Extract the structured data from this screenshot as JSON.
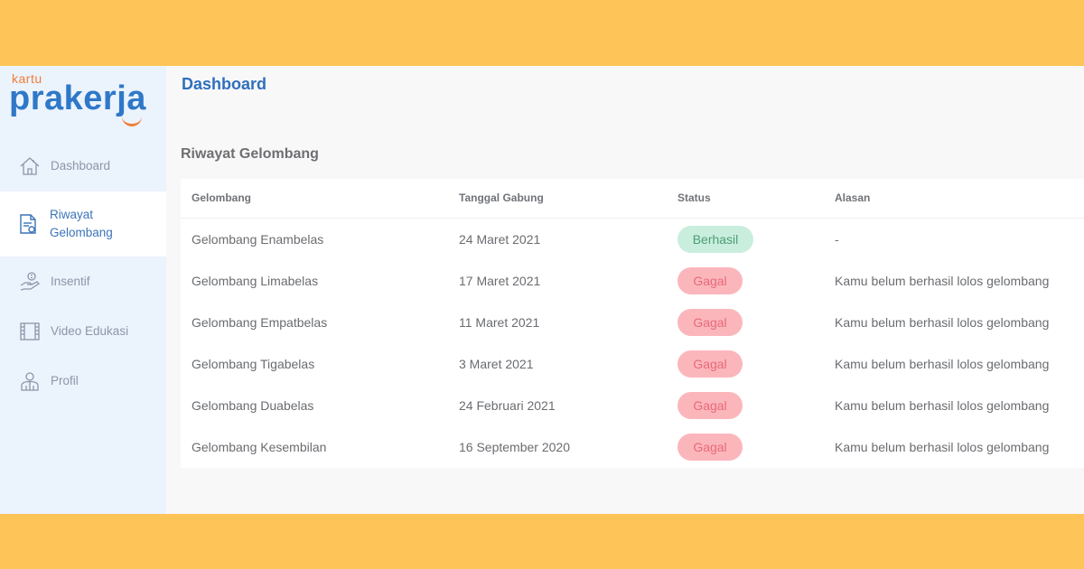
{
  "brand": {
    "kartu": "kartu",
    "name": "prakerja"
  },
  "header": {
    "title": "Dashboard"
  },
  "sidebar": {
    "items": [
      {
        "label": "Dashboard",
        "icon": "home-icon"
      },
      {
        "label": "Riwayat Gelombang",
        "icon": "document-icon"
      },
      {
        "label": "Insentif",
        "icon": "money-hand-icon"
      },
      {
        "label": "Video Edukasi",
        "icon": "film-icon"
      },
      {
        "label": "Profil",
        "icon": "user-icon"
      }
    ],
    "active": "Riwayat Gelombang"
  },
  "section": {
    "title": "Riwayat Gelombang"
  },
  "table": {
    "columns": [
      "Gelombang",
      "Tanggal Gabung",
      "Status",
      "Alasan"
    ],
    "rows": [
      {
        "gelombang": "Gelombang Enambelas",
        "tanggal": "24 Maret 2021",
        "status": "Berhasil",
        "alasan": "-"
      },
      {
        "gelombang": "Gelombang Limabelas",
        "tanggal": "17 Maret 2021",
        "status": "Gagal",
        "alasan": "Kamu belum berhasil lolos gelombang"
      },
      {
        "gelombang": "Gelombang Empatbelas",
        "tanggal": "11 Maret 2021",
        "status": "Gagal",
        "alasan": "Kamu belum berhasil lolos gelombang"
      },
      {
        "gelombang": "Gelombang Tigabelas",
        "tanggal": "3 Maret 2021",
        "status": "Gagal",
        "alasan": "Kamu belum berhasil lolos gelombang"
      },
      {
        "gelombang": "Gelombang Duabelas",
        "tanggal": "24 Februari 2021",
        "status": "Gagal",
        "alasan": "Kamu belum berhasil lolos gelombang"
      },
      {
        "gelombang": "Gelombang Kesembilan",
        "tanggal": "16 September 2020",
        "status": "Gagal",
        "alasan": "Kamu belum berhasil lolos gelombang"
      }
    ]
  },
  "colors": {
    "frame_background": "#fec457",
    "accent": "#2f78c8",
    "brand_orange": "#f07d34",
    "success_bg": "#c9eedd",
    "success_text": "#4c9c76",
    "fail_bg": "#fbb6bc",
    "fail_text": "#e86a78"
  }
}
